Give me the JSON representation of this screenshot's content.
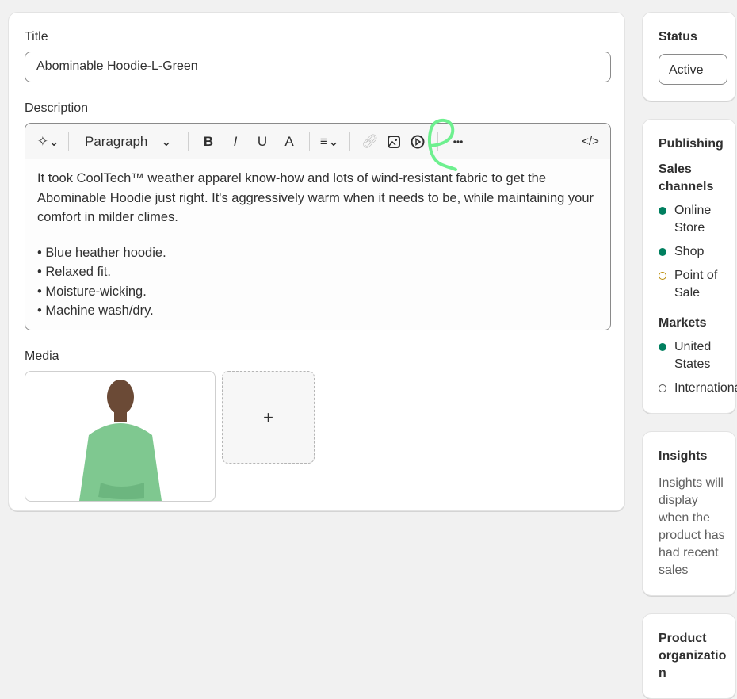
{
  "title": {
    "label": "Title",
    "value": "Abominable Hoodie-L-Green"
  },
  "description": {
    "label": "Description",
    "toolbar": {
      "format": "Paragraph",
      "bold": "B",
      "italic": "I",
      "underline": "U",
      "color": "A",
      "more": "•••",
      "code": "</>"
    },
    "paragraph": "It took CoolTech™ weather apparel know-how and lots of wind-resistant fabric to get the Abominable Hoodie just right. It's aggressively warm when it needs to be, while maintaining your comfort in milder climes.",
    "bullets": [
      "• Blue heather hoodie.",
      "• Relaxed fit.",
      "• Moisture-wicking.",
      "• Machine wash/dry."
    ]
  },
  "media": {
    "label": "Media",
    "add": "+"
  },
  "status": {
    "label": "Status",
    "value": "Active"
  },
  "publishing": {
    "label": "Publishing",
    "sales_label": "Sales channels",
    "channels": [
      "Online Store",
      "Shop",
      "Point of Sale"
    ],
    "markets_label": "Markets",
    "markets": [
      "United States",
      "International"
    ]
  },
  "insights": {
    "label": "Insights",
    "text1": "Insights will display when the product has",
    "text2": "had recent sales"
  },
  "organization": {
    "label": "Product organization"
  },
  "colors": {
    "green": "#007f5f",
    "pending": "#b98900",
    "annotation": "#6ef08f"
  }
}
